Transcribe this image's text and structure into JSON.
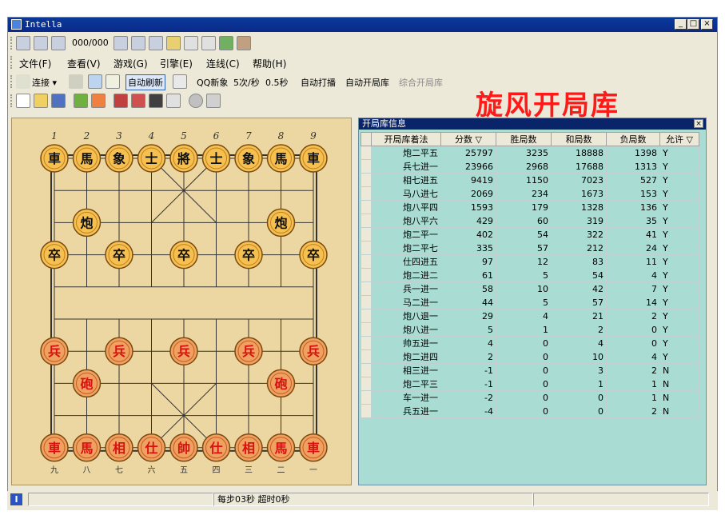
{
  "window": {
    "title": "Intella"
  },
  "nav_toolbar": {
    "counter": "000/000"
  },
  "menu": [
    "文件(F)",
    "查看(V)",
    "游戏(G)",
    "引擎(E)",
    "连线(C)",
    "帮助(H)"
  ],
  "engine_toolbar": {
    "connect": "连接",
    "auto_refresh": "自动刷新",
    "qq_new_game": "QQ新象",
    "rate": "5次/秒",
    "interval": "0.5秒",
    "auto_broadcast": "自动打播",
    "auto_opening_book": "自动开局库",
    "combined_opening_book": "综合开局库"
  },
  "brand": "旋风开局库",
  "board": {
    "top_files": [
      "1",
      "2",
      "3",
      "4",
      "5",
      "6",
      "7",
      "8",
      "9"
    ],
    "bottom_files": [
      "九",
      "八",
      "七",
      "六",
      "五",
      "四",
      "三",
      "二",
      "一"
    ],
    "pieces": [
      {
        "ch": "車",
        "side": "black",
        "file": 0,
        "rank": 0
      },
      {
        "ch": "馬",
        "side": "black",
        "file": 1,
        "rank": 0
      },
      {
        "ch": "象",
        "side": "black",
        "file": 2,
        "rank": 0
      },
      {
        "ch": "士",
        "side": "black",
        "file": 3,
        "rank": 0
      },
      {
        "ch": "將",
        "side": "black",
        "file": 4,
        "rank": 0
      },
      {
        "ch": "士",
        "side": "black",
        "file": 5,
        "rank": 0
      },
      {
        "ch": "象",
        "side": "black",
        "file": 6,
        "rank": 0
      },
      {
        "ch": "馬",
        "side": "black",
        "file": 7,
        "rank": 0
      },
      {
        "ch": "車",
        "side": "black",
        "file": 8,
        "rank": 0
      },
      {
        "ch": "炮",
        "side": "black",
        "file": 1,
        "rank": 2
      },
      {
        "ch": "炮",
        "side": "black",
        "file": 7,
        "rank": 2
      },
      {
        "ch": "卒",
        "side": "black",
        "file": 0,
        "rank": 3
      },
      {
        "ch": "卒",
        "side": "black",
        "file": 2,
        "rank": 3
      },
      {
        "ch": "卒",
        "side": "black",
        "file": 4,
        "rank": 3
      },
      {
        "ch": "卒",
        "side": "black",
        "file": 6,
        "rank": 3
      },
      {
        "ch": "卒",
        "side": "black",
        "file": 8,
        "rank": 3
      },
      {
        "ch": "兵",
        "side": "red",
        "file": 0,
        "rank": 6
      },
      {
        "ch": "兵",
        "side": "red",
        "file": 2,
        "rank": 6
      },
      {
        "ch": "兵",
        "side": "red",
        "file": 4,
        "rank": 6
      },
      {
        "ch": "兵",
        "side": "red",
        "file": 6,
        "rank": 6
      },
      {
        "ch": "兵",
        "side": "red",
        "file": 8,
        "rank": 6
      },
      {
        "ch": "砲",
        "side": "red",
        "file": 1,
        "rank": 7
      },
      {
        "ch": "砲",
        "side": "red",
        "file": 7,
        "rank": 7
      },
      {
        "ch": "車",
        "side": "red",
        "file": 0,
        "rank": 9
      },
      {
        "ch": "馬",
        "side": "red",
        "file": 1,
        "rank": 9
      },
      {
        "ch": "相",
        "side": "red",
        "file": 2,
        "rank": 9
      },
      {
        "ch": "仕",
        "side": "red",
        "file": 3,
        "rank": 9
      },
      {
        "ch": "帥",
        "side": "red",
        "file": 4,
        "rank": 9
      },
      {
        "ch": "仕",
        "side": "red",
        "file": 5,
        "rank": 9
      },
      {
        "ch": "相",
        "side": "red",
        "file": 6,
        "rank": 9
      },
      {
        "ch": "馬",
        "side": "red",
        "file": 7,
        "rank": 9
      },
      {
        "ch": "車",
        "side": "red",
        "file": 8,
        "rank": 9
      }
    ]
  },
  "panel": {
    "title": "开局库信息",
    "columns": [
      "开局库着法",
      "分数",
      "胜局数",
      "和局数",
      "负局数",
      "允许"
    ],
    "rows": [
      [
        "炮二平五",
        "25797",
        "3235",
        "18888",
        "1398",
        "Y"
      ],
      [
        "兵七进一",
        "23966",
        "2968",
        "17688",
        "1313",
        "Y"
      ],
      [
        "相七进五",
        "9419",
        "1150",
        "7023",
        "527",
        "Y"
      ],
      [
        "马八进七",
        "2069",
        "234",
        "1673",
        "153",
        "Y"
      ],
      [
        "炮八平四",
        "1593",
        "179",
        "1328",
        "136",
        "Y"
      ],
      [
        "炮八平六",
        "429",
        "60",
        "319",
        "35",
        "Y"
      ],
      [
        "炮二平一",
        "402",
        "54",
        "322",
        "41",
        "Y"
      ],
      [
        "炮二平七",
        "335",
        "57",
        "212",
        "24",
        "Y"
      ],
      [
        "仕四进五",
        "97",
        "12",
        "83",
        "11",
        "Y"
      ],
      [
        "炮二进二",
        "61",
        "5",
        "54",
        "4",
        "Y"
      ],
      [
        "兵一进一",
        "58",
        "10",
        "42",
        "7",
        "Y"
      ],
      [
        "马二进一",
        "44",
        "5",
        "57",
        "14",
        "Y"
      ],
      [
        "炮八退一",
        "29",
        "4",
        "21",
        "2",
        "Y"
      ],
      [
        "炮八进一",
        "5",
        "1",
        "2",
        "0",
        "Y"
      ],
      [
        "帅五进一",
        "4",
        "0",
        "4",
        "0",
        "Y"
      ],
      [
        "炮二进四",
        "2",
        "0",
        "10",
        "4",
        "Y"
      ],
      [
        "相三进一",
        "-1",
        "0",
        "3",
        "2",
        "N"
      ],
      [
        "炮二平三",
        "-1",
        "0",
        "1",
        "1",
        "N"
      ],
      [
        "车一进一",
        "-2",
        "0",
        "0",
        "1",
        "N"
      ],
      [
        "兵五进一",
        "-4",
        "0",
        "0",
        "2",
        "N"
      ]
    ]
  },
  "status": {
    "time_text": "每步03秒 超时0秒"
  },
  "colors": {
    "title_bar": "#0a246a",
    "brand": "#ff1a1a",
    "panel_bg": "#a9dcd2",
    "board_bg": "#ecd7a3"
  }
}
